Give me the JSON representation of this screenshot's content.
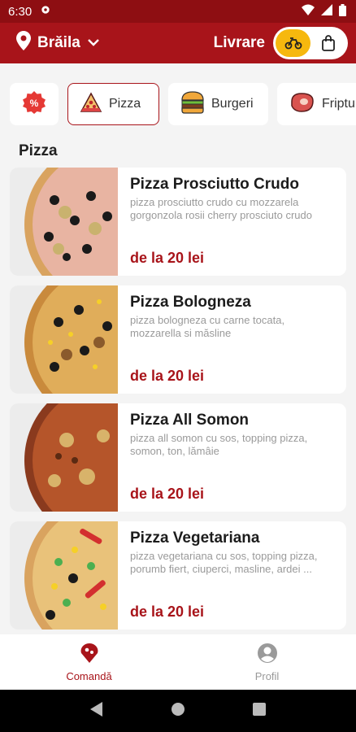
{
  "status_bar": {
    "time": "6:30"
  },
  "header": {
    "city": "Brăila",
    "delivery_mode": "Livrare",
    "toggle_options": [
      "delivery-scooter-icon",
      "pickup-bag-icon"
    ],
    "accent_color": "#a8141a",
    "toggle_active_color": "#f6b80e"
  },
  "categories": [
    {
      "label": "",
      "icon": "discount-percent-icon"
    },
    {
      "label": "Pizza",
      "icon": "pizza-slice-icon",
      "active": true
    },
    {
      "label": "Burgeri",
      "icon": "burger-icon"
    },
    {
      "label": "Fripturi",
      "icon": "steak-icon"
    }
  ],
  "section": {
    "title": "Pizza"
  },
  "products": [
    {
      "name": "Pizza Prosciutto Crudo",
      "description": "pizza prosciutto crudo cu mozzarela gorgonzola rosii cherry prosciuto crudo",
      "price": "de la 20 lei"
    },
    {
      "name": "Pizza Bologneza",
      "description": "pizza bologneza cu carne tocata, mozzarella si măsline",
      "price": "de la 20 lei"
    },
    {
      "name": "Pizza All Somon",
      "description": "pizza all somon cu sos, topping pizza, somon, ton, lămâie",
      "price": "de la 20 lei"
    },
    {
      "name": "Pizza Vegetariana",
      "description": "pizza vegetariana cu sos, topping pizza, porumb fiert, ciuperci, masline, ardei ...",
      "price": "de la 20 lei"
    }
  ],
  "bottom_nav": [
    {
      "label": "Comandă",
      "icon": "pizza-order-icon",
      "active": true
    },
    {
      "label": "Profil",
      "icon": "profile-icon",
      "active": false
    }
  ]
}
